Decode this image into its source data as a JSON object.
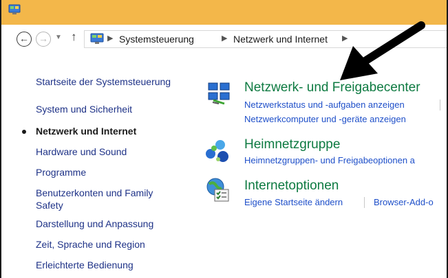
{
  "breadcrumb": {
    "items": [
      "Systemsteuerung",
      "Netzwerk und Internet"
    ]
  },
  "sidebar": {
    "items": [
      {
        "label": "Startseite der Systemsteuerung"
      },
      {
        "label": "System und Sicherheit"
      },
      {
        "label": "Netzwerk und Internet",
        "current": true
      },
      {
        "label": "Hardware und Sound"
      },
      {
        "label": "Programme"
      },
      {
        "label": "Benutzerkonten und Family",
        "label2": "Safety"
      },
      {
        "label": "Darstellung und Anpassung"
      },
      {
        "label": "Zeit, Sprache und Region"
      },
      {
        "label": "Erleichterte Bedienung"
      }
    ]
  },
  "categories": [
    {
      "title": "Netzwerk- und Freigabecenter",
      "icon": "network-sharing-icon",
      "links": [
        "Netzwerkstatus und -aufgaben anzeigen",
        "Netzwerkcomputer und -geräte anzeigen"
      ]
    },
    {
      "title": "Heimnetzgruppe",
      "icon": "homegroup-icon",
      "links": [
        "Heimnetzgruppen- und Freigabeoptionen a"
      ]
    },
    {
      "title": "Internetoptionen",
      "icon": "internet-options-icon",
      "links": [
        "Eigene Startseite ändern",
        "Browser-Add-o"
      ]
    }
  ],
  "colors": {
    "titlebar": "#f3b74a",
    "category_title": "#0d7a41",
    "link": "#1e4fc9",
    "sidebar_link": "#1e3287"
  }
}
